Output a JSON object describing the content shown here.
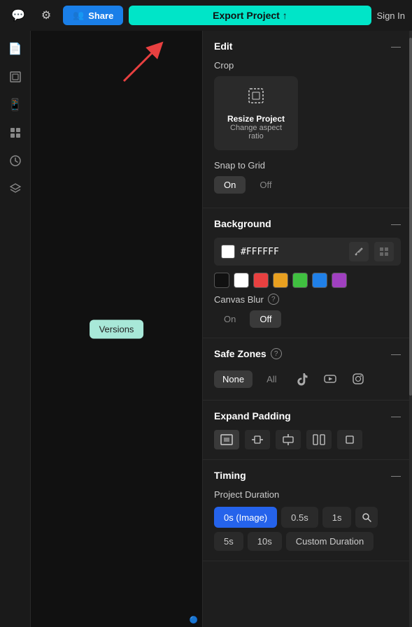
{
  "topbar": {
    "chat_icon": "💬",
    "settings_icon": "⚙",
    "share_label": "Share",
    "export_label": "Export Project ↑",
    "signin_label": "Sign In"
  },
  "sidebar": {
    "icons": [
      "📄",
      "⬜",
      "📱",
      "⊞",
      "🕐",
      "◈"
    ]
  },
  "versions": {
    "label": "Versions"
  },
  "panel": {
    "edit_title": "Edit",
    "crop_label": "Crop",
    "resize_title": "Resize Project",
    "resize_subtitle": "Change aspect ratio",
    "snap_label": "Snap to Grid",
    "snap_on": "On",
    "snap_off": "Off",
    "background_title": "Background",
    "hex_value": "#FFFFFF",
    "canvas_blur_label": "Canvas Blur",
    "blur_on": "On",
    "blur_off": "Off",
    "safe_zones_title": "Safe Zones",
    "safe_none": "None",
    "safe_all": "All",
    "expand_padding_title": "Expand Padding",
    "timing_title": "Timing",
    "project_duration_label": "Project Duration",
    "dur_0s": "0s (Image)",
    "dur_05s": "0.5s",
    "dur_1s": "1s",
    "dur_5s": "5s",
    "dur_10s": "10s",
    "dur_custom": "Custom Duration"
  },
  "swatches": [
    "#111111",
    "#ffffff",
    "#e84040",
    "#e8a020",
    "#40c040",
    "#2080e8",
    "#a040c0"
  ]
}
